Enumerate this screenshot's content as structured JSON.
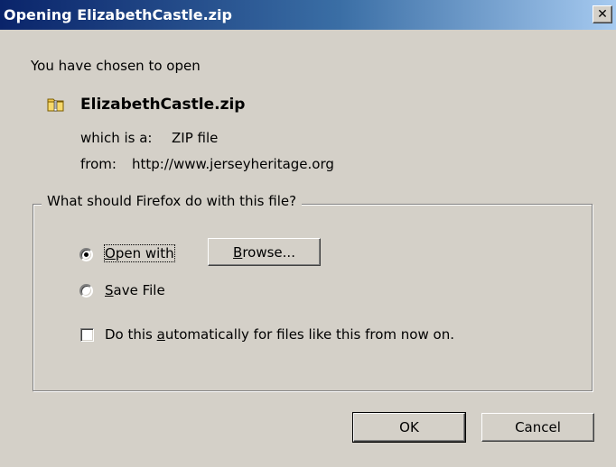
{
  "window": {
    "title": "Opening ElizabethCastle.zip",
    "close_glyph": "✕"
  },
  "intro": "You have chosen to open",
  "file": {
    "name": "ElizabethCastle.zip",
    "icon": "zip-folder-icon",
    "type_label": "which is a:",
    "type_value": "ZIP file",
    "from_label": "from:",
    "from_value": "http://www.jerseyheritage.org"
  },
  "group": {
    "legend": "What should Firefox do with this file?",
    "open_with": {
      "accel": "O",
      "rest": "pen with",
      "selected": true
    },
    "browse": {
      "accel": "B",
      "rest": "rowse..."
    },
    "save_file": {
      "accel": "S",
      "rest": "ave File",
      "selected": false
    },
    "auto": {
      "before": "Do this ",
      "accel": "a",
      "after": "utomatically for files like this from now on.",
      "checked": false
    }
  },
  "buttons": {
    "ok": "OK",
    "cancel": "Cancel"
  },
  "colors": {
    "title_start": "#0a246a",
    "title_end": "#a6caf0",
    "dialog_bg": "#d4d0c8"
  }
}
